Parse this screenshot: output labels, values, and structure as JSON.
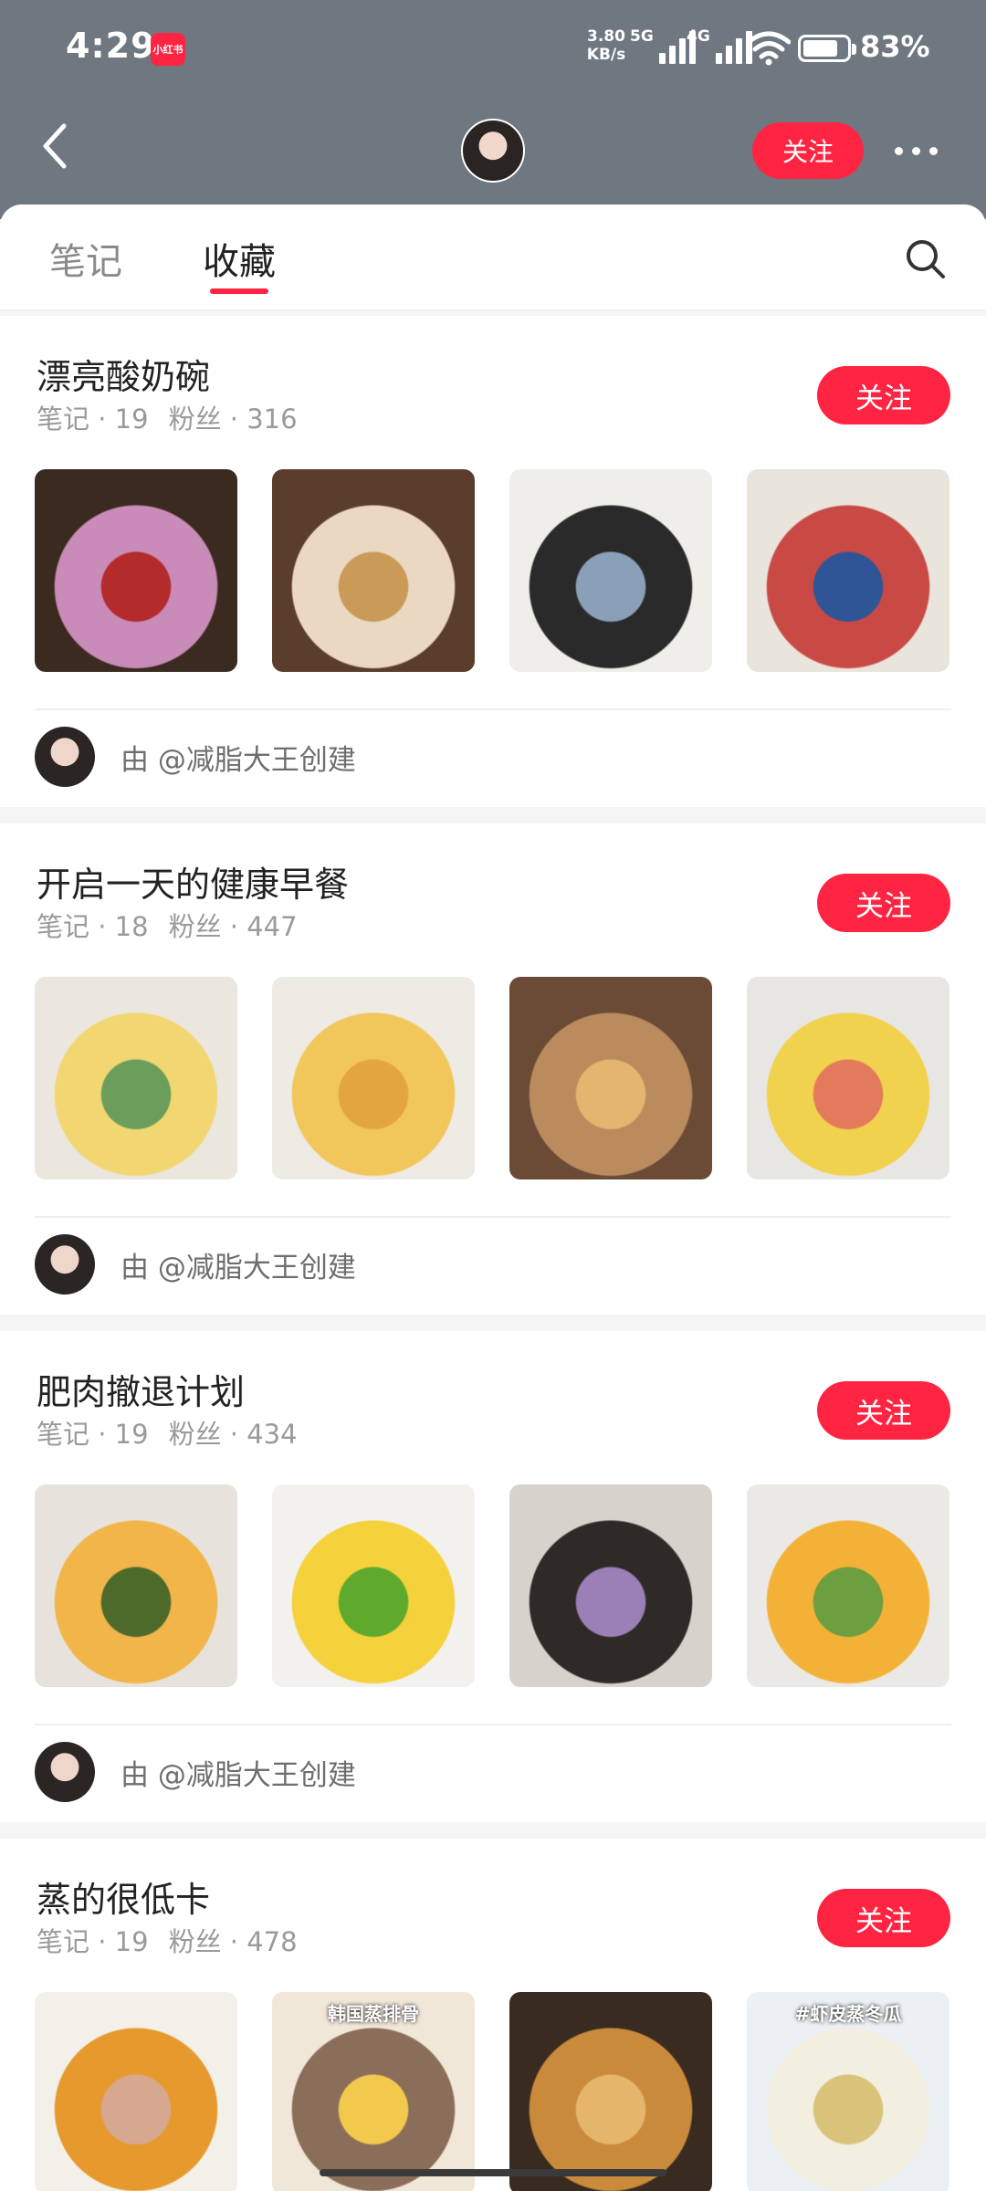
{
  "status_bar": {
    "time": "4:29",
    "app_badge": "小红书",
    "net_speed_value": "3.80",
    "net_speed_unit": "KB/s",
    "sim1": "5G",
    "sim2": "4G",
    "battery_pct": "83%",
    "battery_level": 0.83
  },
  "header": {
    "follow_label": "关注"
  },
  "tabs": [
    {
      "label": "笔记",
      "active": false
    },
    {
      "label": "收藏",
      "active": true
    }
  ],
  "collections": [
    {
      "title": "漂亮酸奶碗",
      "notes_label": "笔记 · 19",
      "fans_label": "粉丝 · 316",
      "follow_label": "关注",
      "creator": "由 @减脂大王创建",
      "thumb_colors": [
        [
          "#3b2a1f",
          "#c98bb8",
          "#b32b2b"
        ],
        [
          "#5a3d2a",
          "#ead8c3",
          "#c99a58"
        ],
        [
          "#f0eee9",
          "#2a2a2a",
          "#8aa0b8"
        ],
        [
          "#e9e5dd",
          "#c94a45",
          "#2f5596"
        ]
      ]
    },
    {
      "title": "开启一天的健康早餐",
      "notes_label": "笔记 · 18",
      "fans_label": "粉丝 · 447",
      "follow_label": "关注",
      "creator": "由 @减脂大王创建",
      "thumb_colors": [
        [
          "#ebe6de",
          "#f2d671",
          "#6b9e5a"
        ],
        [
          "#eeeae4",
          "#f1c65a",
          "#e3a53d"
        ],
        [
          "#6b4a36",
          "#b98b5d",
          "#e4b56f"
        ],
        [
          "#e8e6e2",
          "#f0d24e",
          "#e37a5b"
        ]
      ]
    },
    {
      "title": "肥肉撤退计划",
      "notes_label": "笔记 · 19",
      "fans_label": "粉丝 · 434",
      "follow_label": "关注",
      "creator": "由 @减脂大王创建",
      "thumb_colors": [
        [
          "#e7e3dc",
          "#f1b54a",
          "#4d6a2b"
        ],
        [
          "#f2f1ee",
          "#f5d13c",
          "#5faa2c"
        ],
        [
          "#d8d2cd",
          "#2f2a28",
          "#9b7fb7"
        ],
        [
          "#ebe9e6",
          "#f3b237",
          "#6d9e3f"
        ]
      ]
    },
    {
      "title": "蒸的很低卡",
      "notes_label": "笔记 · 19",
      "fans_label": "粉丝 · 478",
      "follow_label": "关注",
      "creator": "",
      "thumb_texts": [
        "",
        "韩国蒸排骨",
        "",
        "#虾皮蒸冬瓜"
      ],
      "thumb_colors": [
        [
          "#f3f0ea",
          "#e69a2e",
          "#d7a890"
        ],
        [
          "#f1e7d8",
          "#8b6e5a",
          "#f2c94c"
        ],
        [
          "#3a2b20",
          "#c98b3b",
          "#e4b56a"
        ],
        [
          "#eaf0f3",
          "#f2efe0",
          "#d9c37a"
        ]
      ]
    }
  ]
}
